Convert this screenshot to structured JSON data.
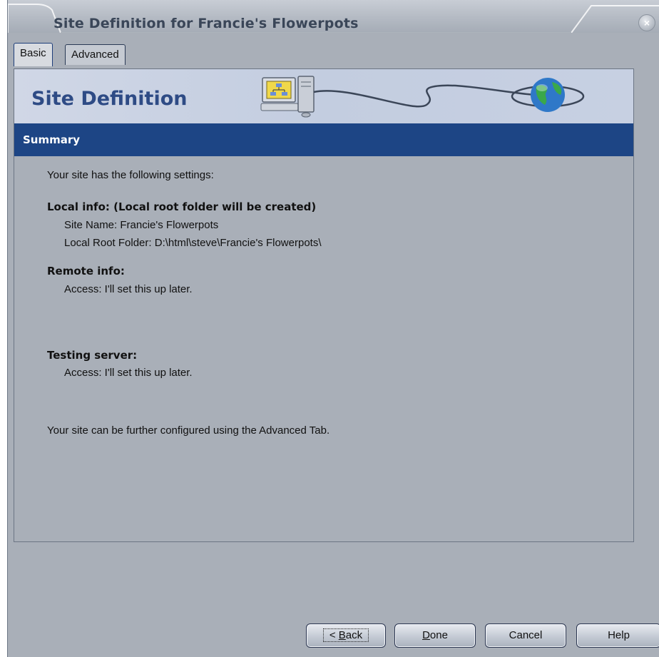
{
  "window": {
    "title": "Site Definition for Francie's Flowerpots",
    "close_symbol": "×"
  },
  "tabs": [
    {
      "label": "Basic",
      "active": true
    },
    {
      "label": "Advanced",
      "active": false
    }
  ],
  "banner": {
    "title": "Site Definition",
    "icons": [
      "computer-icon",
      "globe-icon"
    ]
  },
  "section": {
    "title": "Summary"
  },
  "summary": {
    "intro": "Your site has the following settings:",
    "local_heading": "Local info: (Local root folder will be created)",
    "site_name": "Site Name: Francie's Flowerpots",
    "local_root": "Local Root Folder: D:\\html\\steve\\Francie's Flowerpots\\",
    "remote_heading": "Remote info:",
    "remote_access": "Access: I'll set this up later.",
    "testing_heading": "Testing server:",
    "testing_access": "Access: I'll set this up later.",
    "footer": "Your site can be further configured using the Advanced Tab."
  },
  "buttons": {
    "back_prefix": "< ",
    "back_accel": "B",
    "back_rest": "ack",
    "done_accel": "D",
    "done_rest": "one",
    "cancel": "Cancel",
    "help": "Help"
  },
  "colors": {
    "summary_bar": "#1d4585",
    "banner_title": "#2e4b85",
    "window_bg": "#a9afb8"
  }
}
